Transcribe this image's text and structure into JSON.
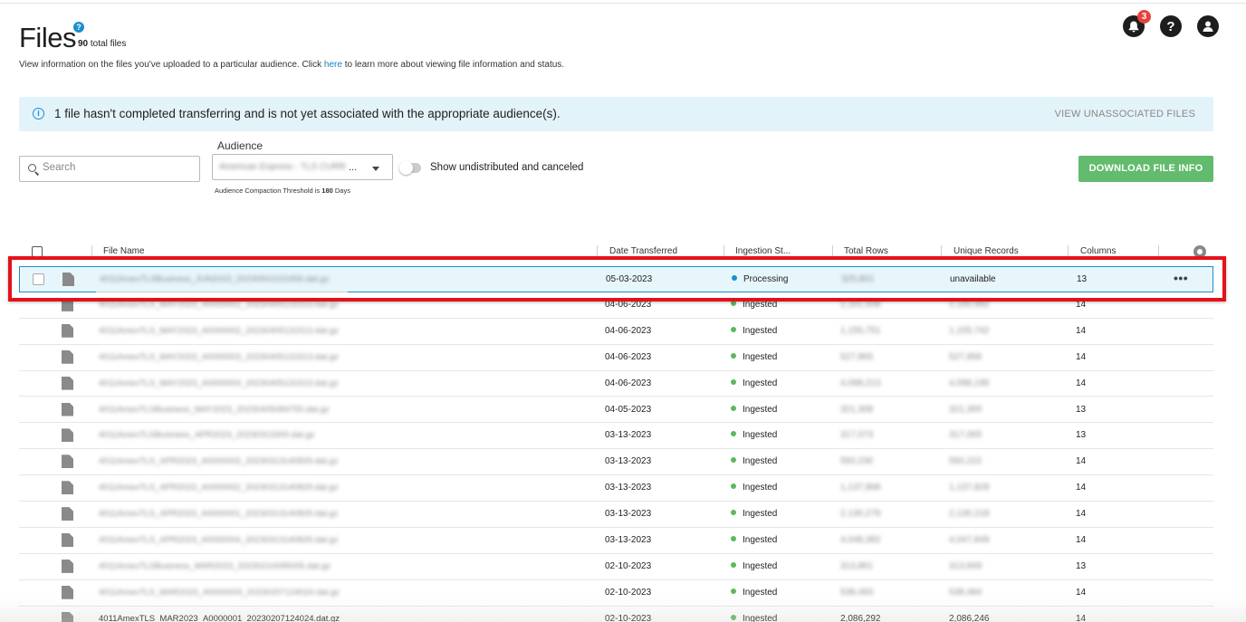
{
  "header": {
    "title": "Files",
    "help_badge": "?",
    "total_count": "90",
    "total_suffix": "total files",
    "subtitle_before": "View information on the files you've uploaded to a particular audience. Click ",
    "subtitle_link": "here",
    "subtitle_after": " to learn more about viewing file information and status.",
    "notification_count": "3",
    "help_icon_glyph": "?"
  },
  "banner": {
    "message": "1 file hasn't completed transferring and is not yet associated with the appropriate audience(s).",
    "link": "VIEW UNASSOCIATED FILES"
  },
  "filters": {
    "search_placeholder": "Search",
    "audience_label": "Audience",
    "audience_value": "American Express - TLS CURR",
    "audience_ellipsis": "...",
    "threshold_text": "Audience Compaction Threshold is",
    "threshold_value": "180",
    "threshold_unit": "Days",
    "toggle_label": "Show undistributed and canceled",
    "toggle_on": false,
    "download_button": "DOWNLOAD FILE INFO"
  },
  "table": {
    "columns": [
      "File Name",
      "Date Transferred",
      "Ingestion St...",
      "Total Rows",
      "Unique Records",
      "Columns"
    ],
    "rows": [
      {
        "name": "4011AmexTLSBusiness_JUN2023_20230502102456.dat.gz",
        "date": "05-03-2023",
        "status": "Processing",
        "total": "325,801",
        "unique": "unavailable",
        "cols": "13",
        "selected": true
      },
      {
        "name": "4011AmexTLS_MAY2023_A0000001_20230405131513.dat.gz",
        "date": "04-06-2023",
        "status": "Ingested",
        "total": "2,161,508",
        "unique": "2,160,992",
        "cols": "14"
      },
      {
        "name": "4011AmexTLS_MAY2023_A0000002_20230405131513.dat.gz",
        "date": "04-06-2023",
        "status": "Ingested",
        "total": "1,155,751",
        "unique": "1,155,742",
        "cols": "14"
      },
      {
        "name": "4011AmexTLS_MAY2023_A0000003_20230405131513.dat.gz",
        "date": "04-06-2023",
        "status": "Ingested",
        "total": "527,865",
        "unique": "527,856",
        "cols": "14"
      },
      {
        "name": "4011AmexTLS_MAY2023_A0000004_20230405131513.dat.gz",
        "date": "04-06-2023",
        "status": "Ingested",
        "total": "4,098,213",
        "unique": "4,098,195",
        "cols": "14"
      },
      {
        "name": "4011AmexTLSBusiness_MAY2023_20230405084755.dat.gz",
        "date": "04-05-2023",
        "status": "Ingested",
        "total": "321,308",
        "unique": "321,300",
        "cols": "13"
      },
      {
        "name": "4011AmexTLSBusiness_APR2023_20230313300.dat.gz",
        "date": "03-13-2023",
        "status": "Ingested",
        "total": "317,073",
        "unique": "317,065",
        "cols": "13"
      },
      {
        "name": "4011AmexTLS_APR2023_A0000003_20230313140829.dat.gz",
        "date": "03-13-2023",
        "status": "Ingested",
        "total": "550,230",
        "unique": "550,222",
        "cols": "14"
      },
      {
        "name": "4011AmexTLS_APR2023_A0000002_20230313140829.dat.gz",
        "date": "03-13-2023",
        "status": "Ingested",
        "total": "1,137,868",
        "unique": "1,137,829",
        "cols": "14"
      },
      {
        "name": "4011AmexTLS_APR2023_A0000001_20230313140829.dat.gz",
        "date": "03-13-2023",
        "status": "Ingested",
        "total": "2,130,279",
        "unique": "2,130,218",
        "cols": "14"
      },
      {
        "name": "4011AmexTLS_APR2023_A0000004_20230313140829.dat.gz",
        "date": "03-13-2023",
        "status": "Ingested",
        "total": "4,048,382",
        "unique": "4,047,849",
        "cols": "14"
      },
      {
        "name": "4011AmexTLSBusiness_MAR2023_20230210095005.dat.gz",
        "date": "02-10-2023",
        "status": "Ingested",
        "total": "313,861",
        "unique": "313,849",
        "cols": "13"
      },
      {
        "name": "4011AmexTLS_MAR2023_A0000003_20230207124024.dat.gz",
        "date": "02-10-2023",
        "status": "Ingested",
        "total": "538,493",
        "unique": "538,484",
        "cols": "14"
      },
      {
        "name": "4011AmexTLS_MAR2023_A0000001_20230207124024.dat.gz",
        "date": "02-10-2023",
        "status": "Ingested",
        "total": "2,086,292",
        "unique": "2,086,246",
        "cols": "14",
        "clear": true
      }
    ]
  },
  "colors": {
    "accent_blue": "#1a8fd0",
    "ingested_green": "#5cb85c",
    "download_green": "#63bb6e",
    "highlight_red": "#e3121a",
    "notification_red": "#e8413b"
  }
}
